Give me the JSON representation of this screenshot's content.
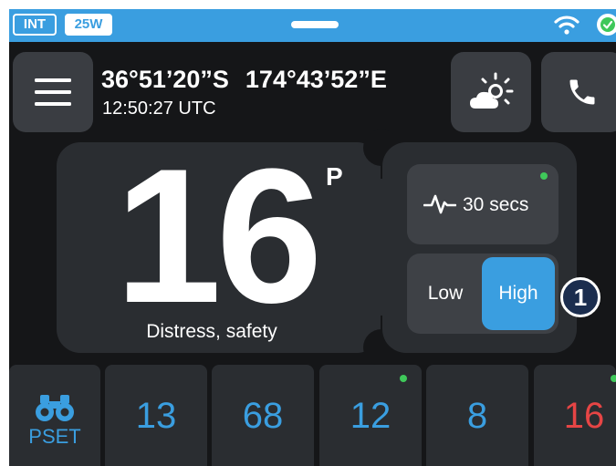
{
  "status": {
    "intl_badge": "INT",
    "power_badge": "25W"
  },
  "position": {
    "latitude": "36°51’20”S",
    "longitude": "174°43’52”E",
    "time": "12:50:27 UTC"
  },
  "channel": {
    "number": "16",
    "suffix": "P",
    "description": "Distress, safety"
  },
  "controls": {
    "scan_interval": "30 secs",
    "power_low": "Low",
    "power_high": "High",
    "power_selected": "High",
    "callout": "1"
  },
  "presets": {
    "label": "PSET",
    "channels": [
      "13",
      "68",
      "12",
      "8",
      "16"
    ]
  },
  "colors": {
    "accent": "#3a9ee0",
    "background": "#151618",
    "tile": "#2a2d31",
    "indicator": "#3fc85a",
    "emergency": "#e64545"
  },
  "icons": {
    "menu": "menu-icon",
    "weather": "weather-icon",
    "phone": "phone-icon",
    "scan": "pulse-icon",
    "wifi": "wifi-icon",
    "status": "check-icon",
    "preset": "binoculars-icon"
  }
}
